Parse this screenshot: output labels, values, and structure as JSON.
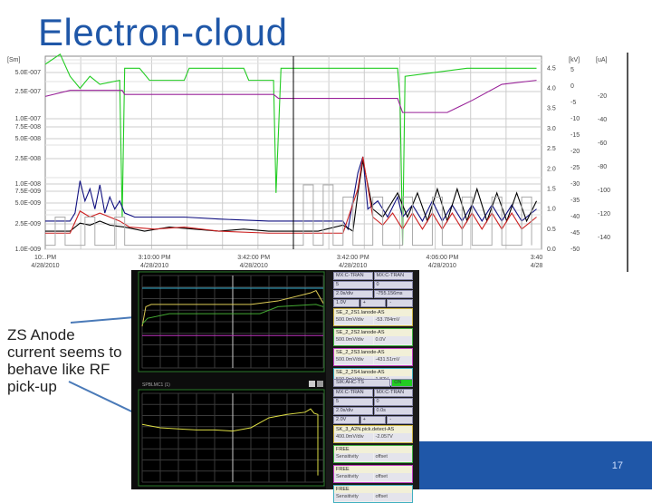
{
  "slide": {
    "title": "Electron-cloud",
    "page_number": "17",
    "callout": "ZS Anode current seems to behave like RF pick-up"
  },
  "chart_data": {
    "type": "line",
    "left_axis": {
      "unit": "[Sm]",
      "ticks": [
        "5.0E-007",
        "2.5E-007",
        "1.0E-007",
        "7.5E-008",
        "5.0E-008",
        "2.5E-008",
        "1.0E-008",
        "7.5E-009",
        "5.0E-009",
        "2.5E-009",
        "1.0E-009"
      ]
    },
    "right_axis": {
      "ticks": [
        "4.5",
        "4.0",
        "3.5",
        "3.0",
        "2.5",
        "2.0",
        "1.5",
        "1.0",
        "0.5",
        "0.0"
      ],
      "range": [
        0,
        4.8
      ]
    },
    "kv_axis": {
      "unit": "[kV]",
      "ticks": [
        "5",
        "0",
        "-5",
        "-10",
        "-15",
        "-20",
        "-25",
        "-30",
        "-35",
        "-40",
        "-45",
        "-50"
      ]
    },
    "ua_axis": {
      "unit": "[uA]",
      "ticks": [
        "-20",
        "-40",
        "-60",
        "-80",
        "-100",
        "-120",
        "-140"
      ]
    },
    "x_ticks": [
      {
        "time": "10:..PM",
        "date": "4/28/2010",
        "t": 0
      },
      {
        "time": "3:10:00 PM",
        "date": "4/28/2010",
        "t": 22
      },
      {
        "time": "3:42:00 PM",
        "date": "4/28/2010",
        "t": 42
      },
      {
        "time": "3:42:00 PM",
        "date": "4/28/2010",
        "t": 62
      },
      {
        "time": "4:06:00 PM",
        "date": "4/28/2010",
        "t": 80
      },
      {
        "time": "3:40",
        "date": "4/28",
        "t": 99
      }
    ],
    "cursor_t": 50,
    "series": [
      {
        "name": "green",
        "color": "#22cc22",
        "points": [
          [
            0,
            4.6
          ],
          [
            3,
            4.85
          ],
          [
            5,
            4.3
          ],
          [
            7,
            4.0
          ],
          [
            9,
            4.3
          ],
          [
            11,
            4.1
          ],
          [
            15,
            4.2
          ],
          [
            15.5,
            0.8
          ],
          [
            16,
            4.5
          ],
          [
            19,
            4.5
          ],
          [
            21,
            4.2
          ],
          [
            28,
            4.2
          ],
          [
            29,
            4.5
          ],
          [
            40,
            4.5
          ],
          [
            41,
            4.2
          ],
          [
            46,
            4.2
          ],
          [
            46.5,
            1.4
          ],
          [
            47.5,
            4.5
          ],
          [
            71,
            4.5
          ],
          [
            71.5,
            3.7
          ],
          [
            72,
            0.1
          ],
          [
            72.5,
            4.3
          ],
          [
            85,
            4.5
          ],
          [
            99,
            4.5
          ]
        ]
      },
      {
        "name": "purple",
        "color": "#992299",
        "points": [
          [
            0,
            3.8
          ],
          [
            5,
            3.95
          ],
          [
            15.5,
            3.95
          ],
          [
            16,
            3.85
          ],
          [
            46,
            3.85
          ],
          [
            47,
            3.75
          ],
          [
            71,
            3.75
          ],
          [
            72,
            3.4
          ],
          [
            81,
            3.4
          ],
          [
            86,
            3.7
          ],
          [
            92,
            4.1
          ],
          [
            99,
            4.2
          ]
        ]
      },
      {
        "name": "blue",
        "color": "#101080",
        "points": [
          [
            0,
            0.7
          ],
          [
            5,
            0.7
          ],
          [
            6,
            0.9
          ],
          [
            7,
            1.7
          ],
          [
            8,
            1.2
          ],
          [
            9,
            1.5
          ],
          [
            10,
            1.0
          ],
          [
            11,
            1.6
          ],
          [
            12,
            0.9
          ],
          [
            13,
            1.3
          ],
          [
            14,
            1.0
          ],
          [
            15,
            1.2
          ],
          [
            16,
            0.9
          ],
          [
            18,
            0.8
          ],
          [
            22,
            0.8
          ],
          [
            28,
            0.8
          ],
          [
            35,
            0.75
          ],
          [
            45,
            0.7
          ],
          [
            60,
            0.7
          ],
          [
            61,
            0.5
          ],
          [
            63,
            1.9
          ],
          [
            64,
            2.3
          ],
          [
            65,
            1.0
          ],
          [
            67,
            1.2
          ],
          [
            69,
            0.8
          ],
          [
            71,
            1.3
          ],
          [
            72,
            0.8
          ],
          [
            74,
            1.1
          ],
          [
            76,
            0.7
          ],
          [
            78,
            1.2
          ],
          [
            80,
            0.7
          ],
          [
            82,
            1.1
          ],
          [
            84,
            0.7
          ],
          [
            86,
            1.1
          ],
          [
            88,
            0.7
          ],
          [
            90,
            1.1
          ],
          [
            92,
            0.7
          ],
          [
            94,
            1.1
          ],
          [
            96,
            0.7
          ],
          [
            99,
            1.0
          ]
        ]
      },
      {
        "name": "black",
        "color": "#000000",
        "points": [
          [
            0,
            0.45
          ],
          [
            5,
            0.45
          ],
          [
            7,
            0.65
          ],
          [
            9,
            0.6
          ],
          [
            11,
            0.7
          ],
          [
            13,
            0.6
          ],
          [
            16,
            0.55
          ],
          [
            20,
            0.45
          ],
          [
            25,
            0.55
          ],
          [
            30,
            0.5
          ],
          [
            35,
            0.45
          ],
          [
            40,
            0.5
          ],
          [
            45,
            0.45
          ],
          [
            50,
            0.45
          ],
          [
            55,
            0.45
          ],
          [
            60,
            0.6
          ],
          [
            62,
            0.45
          ],
          [
            63,
            1.4
          ],
          [
            64,
            2.2
          ],
          [
            66,
            1.0
          ],
          [
            68,
            0.8
          ],
          [
            70,
            1.2
          ],
          [
            71,
            1.4
          ],
          [
            73,
            0.8
          ],
          [
            75,
            1.4
          ],
          [
            77,
            0.7
          ],
          [
            79,
            1.5
          ],
          [
            81,
            0.7
          ],
          [
            83,
            1.5
          ],
          [
            85,
            0.7
          ],
          [
            87,
            1.5
          ],
          [
            89,
            0.7
          ],
          [
            91,
            1.4
          ],
          [
            93,
            0.7
          ],
          [
            95,
            1.4
          ],
          [
            97,
            0.7
          ],
          [
            99,
            1.2
          ]
        ]
      },
      {
        "name": "red",
        "color": "#cc2222",
        "points": [
          [
            0,
            0.4
          ],
          [
            5,
            0.4
          ],
          [
            7,
            0.95
          ],
          [
            9,
            0.8
          ],
          [
            11,
            0.9
          ],
          [
            13,
            0.8
          ],
          [
            15,
            0.7
          ],
          [
            17,
            0.55
          ],
          [
            22,
            0.5
          ],
          [
            28,
            0.55
          ],
          [
            35,
            0.45
          ],
          [
            45,
            0.4
          ],
          [
            55,
            0.4
          ],
          [
            60,
            0.4
          ],
          [
            63,
            1.5
          ],
          [
            64,
            2.3
          ],
          [
            66,
            0.8
          ],
          [
            68,
            0.6
          ],
          [
            70,
            0.9
          ],
          [
            72,
            0.5
          ],
          [
            74,
            0.9
          ],
          [
            76,
            0.5
          ],
          [
            78,
            0.9
          ],
          [
            80,
            0.5
          ],
          [
            82,
            0.9
          ],
          [
            84,
            0.5
          ],
          [
            86,
            0.9
          ],
          [
            88,
            0.5
          ],
          [
            90,
            0.9
          ],
          [
            92,
            0.5
          ],
          [
            94,
            0.9
          ],
          [
            96,
            0.5
          ],
          [
            99,
            0.8
          ]
        ]
      },
      {
        "name": "gray",
        "color": "#aaaaaa",
        "points": [
          [
            0,
            0.1
          ],
          [
            2,
            0.1
          ],
          [
            2,
            0.8
          ],
          [
            4,
            0.8
          ],
          [
            4,
            0.1
          ],
          [
            8,
            0.1
          ],
          [
            8,
            0.8
          ],
          [
            10,
            0.8
          ],
          [
            10,
            0.1
          ],
          [
            14,
            0.1
          ],
          [
            14,
            0.8
          ],
          [
            16,
            0.8
          ],
          [
            16,
            0.1
          ],
          [
            52,
            0.1
          ],
          [
            52,
            1.6
          ],
          [
            54,
            1.6
          ],
          [
            54,
            0.1
          ],
          [
            56,
            0.1
          ],
          [
            56,
            1.6
          ],
          [
            58,
            1.6
          ],
          [
            58,
            0.1
          ],
          [
            60,
            0.1
          ],
          [
            60,
            1.3
          ],
          [
            62,
            1.3
          ],
          [
            62,
            0.1
          ],
          [
            66,
            0.1
          ],
          [
            66,
            1.3
          ],
          [
            68,
            1.3
          ],
          [
            68,
            0.1
          ],
          [
            72,
            0.1
          ],
          [
            72,
            1.3
          ],
          [
            74,
            1.3
          ],
          [
            74,
            0.1
          ],
          [
            78,
            0.1
          ],
          [
            78,
            1.3
          ],
          [
            80,
            1.3
          ],
          [
            80,
            0.1
          ],
          [
            84,
            0.1
          ],
          [
            84,
            1.3
          ],
          [
            86,
            1.3
          ],
          [
            86,
            0.1
          ],
          [
            90,
            0.1
          ],
          [
            90,
            1.3
          ],
          [
            92,
            1.3
          ],
          [
            92,
            0.1
          ],
          [
            96,
            0.1
          ],
          [
            96,
            1.3
          ],
          [
            98,
            1.3
          ],
          [
            98,
            0.1
          ]
        ]
      }
    ]
  },
  "scope": {
    "bottom_label": "SPBLMC1 (1)",
    "top_traces": [
      {
        "name": "cyan",
        "color": "#33aacc",
        "points": [
          [
            0,
            6.9
          ],
          [
            10,
            6.9
          ]
        ]
      },
      {
        "name": "yellow",
        "color": "#ddcc55",
        "points": [
          [
            0,
            3.6
          ],
          [
            0.2,
            5.3
          ],
          [
            0.5,
            5.5
          ],
          [
            6,
            5.5
          ],
          [
            7.5,
            5.8
          ],
          [
            9.3,
            6.5
          ],
          [
            9.6,
            6.7
          ],
          [
            10,
            5.6
          ]
        ]
      },
      {
        "name": "green",
        "color": "#44aa33",
        "points": [
          [
            0,
            3.8
          ],
          [
            0.3,
            4.3
          ],
          [
            1.5,
            4.7
          ],
          [
            6.5,
            4.7
          ],
          [
            7.5,
            5.3
          ],
          [
            9.6,
            5.5
          ],
          [
            10,
            5.3
          ]
        ]
      },
      {
        "name": "magenta",
        "color": "#bb33bb",
        "points": [
          [
            0,
            2.8
          ],
          [
            10,
            2.8
          ]
        ]
      }
    ],
    "bottom_traces": [
      {
        "name": "yellow",
        "color": "#dddd44",
        "points": [
          [
            0,
            5.2
          ],
          [
            1,
            4.9
          ],
          [
            2,
            4.8
          ],
          [
            3,
            4.7
          ],
          [
            4,
            4.7
          ],
          [
            5,
            4.6
          ],
          [
            6,
            4.9
          ],
          [
            7,
            5.8
          ],
          [
            8,
            6.1
          ],
          [
            9,
            6.3
          ],
          [
            9.3,
            6.6
          ],
          [
            9.5,
            6.2
          ],
          [
            9.7,
            6.1
          ],
          [
            9.7,
            0.6
          ]
        ]
      }
    ],
    "controls_top": {
      "rows": [
        [
          "MX:C-TRAN",
          "MX:C-TRAN"
        ],
        [
          "5",
          "0"
        ],
        [
          "2.0s/div",
          "-755.156ms"
        ],
        [
          "1.0V",
          "+",
          "-"
        ]
      ],
      "channels": [
        {
          "name": "SE_2_2S1.lanode-AS",
          "scale": "500.0mV/div",
          "value": "-53.784mV",
          "color": "#c8b040"
        },
        {
          "name": "SE_2_2S2.lanode-AS",
          "scale": "500.0mV/div",
          "value": "0.0V",
          "color": "#40b040"
        },
        {
          "name": "SE_2_2S3.lanode-AS",
          "scale": "500.0mV/div",
          "value": "-431.51mV",
          "color": "#c040c0"
        },
        {
          "name": "SE_2_2S4.lanode-AS",
          "scale": "500.0mV/div",
          "value": "1.82V",
          "color": "#40b0c0"
        }
      ]
    },
    "controls_bottom": {
      "device": "SIK:AHC-TS",
      "on_label": "ON",
      "rows": [
        [
          "MX:C-TRAN",
          "MX:C-TRAN"
        ],
        [
          "5",
          "0"
        ],
        [
          "2.0s/div",
          "0.0s"
        ],
        [
          "2.0V",
          "+",
          "-"
        ]
      ],
      "channels": [
        {
          "name": "SK_3_A2N.pick.detect-AS",
          "scale": "400.0mV/div",
          "value": "-2.057V",
          "color": "#c8b040"
        },
        {
          "name": "FREE",
          "scale": "Sensitivity",
          "value": "offset",
          "color": "#40b040"
        },
        {
          "name": "FREE",
          "scale": "Sensitivity",
          "value": "offset",
          "color": "#c040c0"
        },
        {
          "name": "FREE",
          "scale": "Sensitivity",
          "value": "offset",
          "color": "#40b0c0"
        }
      ]
    }
  }
}
